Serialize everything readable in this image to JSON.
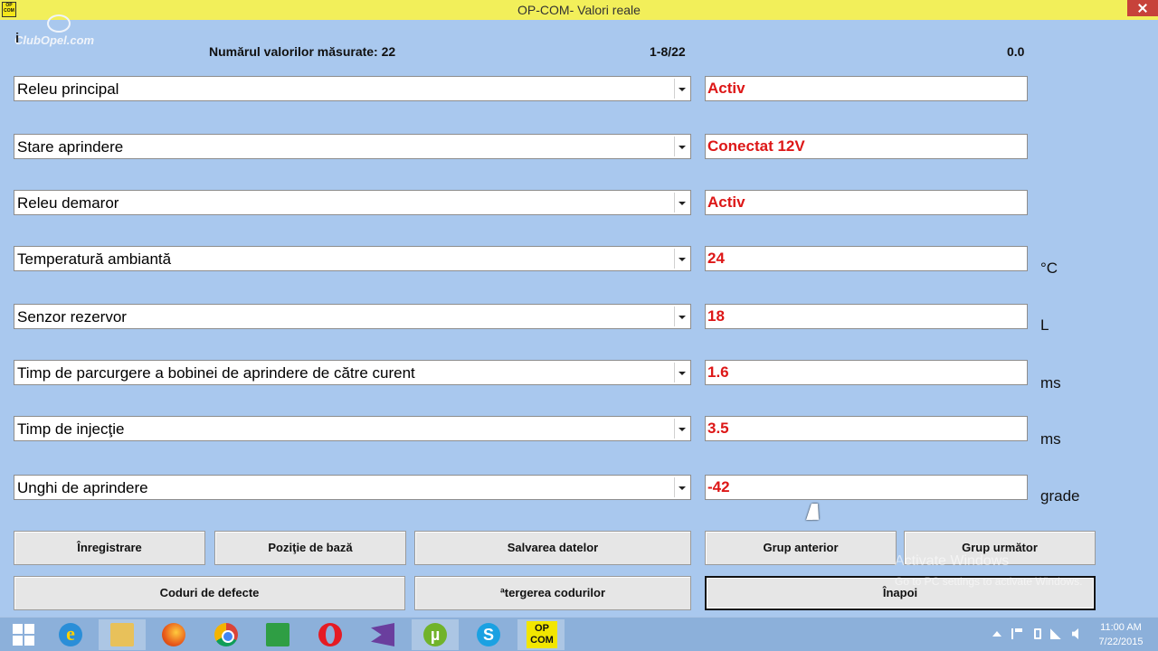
{
  "window": {
    "title": "OP-COM- Valori reale",
    "app_icon_text": "OP COM"
  },
  "watermark": {
    "text": "ClubOpel.com"
  },
  "info_icon": "i",
  "header": {
    "count_label": "Numărul valorilor măsurate: 22",
    "range": "1-8/22",
    "value": "0.0"
  },
  "rows": [
    {
      "label": "Releu principal",
      "value": "Activ",
      "unit": ""
    },
    {
      "label": "Stare aprindere",
      "value": "Conectat 12V",
      "unit": ""
    },
    {
      "label": "Releu demaror",
      "value": "Activ",
      "unit": ""
    },
    {
      "label": "Temperatură ambiantă",
      "value": "24",
      "unit": "°C"
    },
    {
      "label": "Senzor rezervor",
      "value": "18",
      "unit": "L"
    },
    {
      "label": "Timp de parcurgere a bobinei de aprindere de către curent",
      "value": "1.6",
      "unit": "ms"
    },
    {
      "label": "Timp de injecţie",
      "value": "3.5",
      "unit": "ms"
    },
    {
      "label": "Unghi de aprindere",
      "value": "-42",
      "unit": "grade"
    }
  ],
  "buttons": {
    "record": "Înregistrare",
    "base_position": "Poziţie de bază",
    "save_data": "Salvarea datelor",
    "prev_group": "Grup anterior",
    "next_group": "Grup următor",
    "fault_codes": "Coduri de defecte",
    "erase_codes": "ªtergerea codurilor",
    "back": "Înapoi"
  },
  "activate_windows": {
    "line1": "Activate Windows",
    "line2": "Go to PC settings to activate Windows."
  },
  "taskbar": {
    "icons": [
      "windows-logo-icon",
      "internet-explorer-icon",
      "file-explorer-icon",
      "firefox-icon",
      "chrome-icon",
      "windows-store-icon",
      "opera-icon",
      "visual-studio-icon",
      "utorrent-icon",
      "skype-icon",
      "op-com-icon"
    ],
    "opcom_label": "OP COM",
    "ie_glyph": "e",
    "utorrent_glyph": "µ",
    "skype_glyph": "S",
    "time": "11:00 AM",
    "date": "7/22/2015"
  },
  "colors": {
    "background": "#a9c8ee",
    "titlebar": "#f2ef5a",
    "value_text": "#dd1717",
    "close_button": "#c7423a"
  }
}
